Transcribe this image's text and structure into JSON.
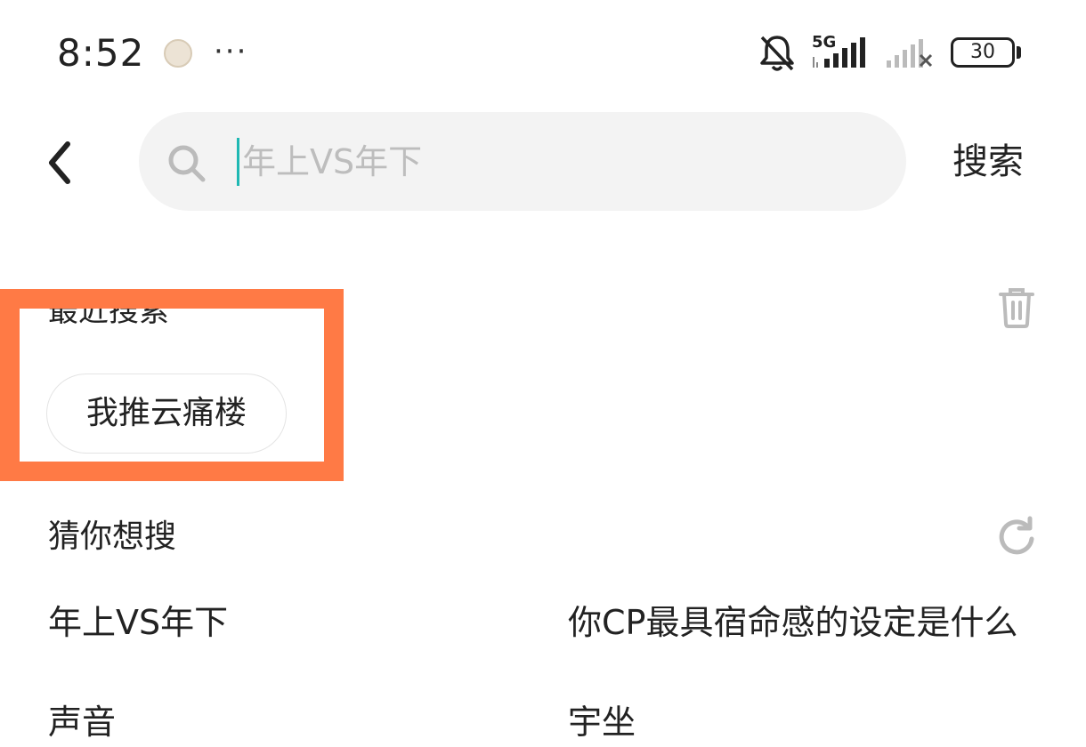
{
  "status_bar": {
    "time": "8:52",
    "more": "···",
    "network": "5G",
    "battery": "30"
  },
  "header": {
    "search_placeholder": "年上VS年下",
    "search_button": "搜索"
  },
  "recent": {
    "title": "最近搜索",
    "items": [
      "我推云痛楼"
    ]
  },
  "guess": {
    "title": "猜你想搜",
    "items": [
      "年上VS年下",
      "你CP最具宿命感的设定是什么",
      "声音",
      "宇坐"
    ]
  },
  "colors": {
    "highlight_border": "#ff7a45",
    "caret": "#1fb8b3",
    "search_bg": "#f3f3f3",
    "placeholder": "#bdbdbd"
  }
}
